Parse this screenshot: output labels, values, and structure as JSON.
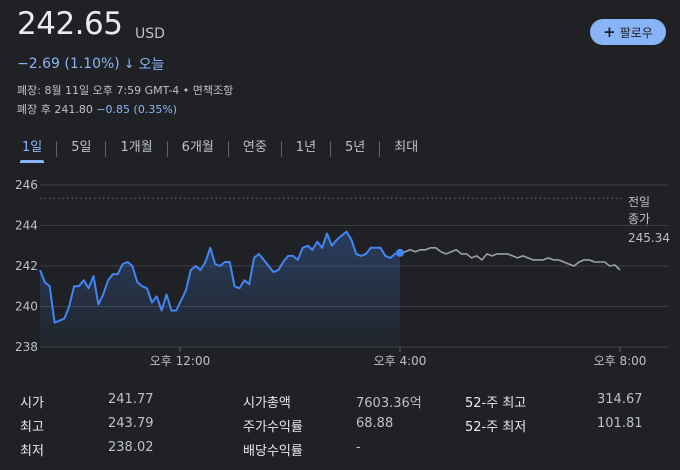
{
  "header": {
    "price": "242.65",
    "currency": "USD",
    "change": "−2.69 (1.10%)",
    "change_arrow": "↓",
    "period": "오늘",
    "follow_label": "팔로우",
    "follow_icon": "plus-icon",
    "closed_text": "폐장: 8월 11일 오후 7:59 GMT-4 • 면책조항",
    "after_label": "폐장 후 241.80",
    "after_change": "−0.85 (0.35%)"
  },
  "tabs": [
    {
      "label": "1일",
      "active": true
    },
    {
      "label": "5일"
    },
    {
      "label": "1개월"
    },
    {
      "label": "6개월"
    },
    {
      "label": "연중"
    },
    {
      "label": "1년"
    },
    {
      "label": "5년"
    },
    {
      "label": "최대"
    }
  ],
  "chart_data": {
    "type": "line",
    "y_ticks": [
      "246",
      "244",
      "242",
      "240",
      "238"
    ],
    "ylim": [
      238,
      246
    ],
    "x_ticks": [
      "오후 12:00",
      "오후 4:00",
      "오후 8:00"
    ],
    "previous_close": {
      "label_line1": "전일",
      "label_line2": "종가",
      "value": "245.34"
    },
    "colors": {
      "regular": "#4285f4",
      "extended": "#9aa0a6",
      "dotted": "#5f6368"
    },
    "regular_session": [
      241.8,
      241.2,
      241.0,
      239.2,
      239.3,
      239.4,
      240.0,
      241.0,
      241.0,
      241.3,
      240.9,
      241.5,
      240.1,
      240.6,
      241.3,
      241.6,
      241.6,
      242.1,
      242.2,
      242.0,
      241.2,
      241.0,
      240.9,
      240.2,
      240.5,
      239.8,
      240.6,
      239.8,
      239.8,
      240.3,
      240.8,
      241.8,
      242.0,
      241.8,
      242.2,
      242.9,
      242.1,
      242.0,
      242.2,
      242.2,
      241.0,
      240.9,
      241.3,
      241.1,
      242.4,
      242.6,
      242.3,
      242.0,
      241.7,
      241.8,
      242.2,
      242.5,
      242.5,
      242.3,
      242.9,
      243.0,
      242.8,
      243.2,
      242.9,
      243.6,
      243.0,
      243.3,
      243.5,
      243.7,
      243.3,
      242.6,
      242.5,
      242.6,
      242.9,
      242.9,
      242.9,
      242.5,
      242.4,
      242.6,
      242.65
    ],
    "extended_session": [
      242.65,
      242.7,
      242.8,
      242.7,
      242.8,
      242.8,
      242.9,
      242.9,
      242.7,
      242.6,
      242.7,
      242.8,
      242.6,
      242.6,
      242.4,
      242.5,
      242.3,
      242.6,
      242.5,
      242.6,
      242.6,
      242.6,
      242.5,
      242.4,
      242.5,
      242.4,
      242.3,
      242.3,
      242.3,
      242.4,
      242.3,
      242.3,
      242.2,
      242.1,
      242.0,
      242.2,
      242.3,
      242.3,
      242.2,
      242.2,
      242.2,
      242.0,
      242.05,
      241.8
    ]
  },
  "stats": [
    {
      "label": "시가",
      "value": "241.77"
    },
    {
      "label": "최고",
      "value": "243.79"
    },
    {
      "label": "최저",
      "value": "238.02"
    },
    {
      "label": "시가총액",
      "value": "7603.36억"
    },
    {
      "label": "주가수익률",
      "value": "68.88"
    },
    {
      "label": "배당수익률",
      "value": "-"
    },
    {
      "label": "52-주 최고",
      "value": "314.67"
    },
    {
      "label": "52-주 최저",
      "value": "101.81"
    }
  ]
}
